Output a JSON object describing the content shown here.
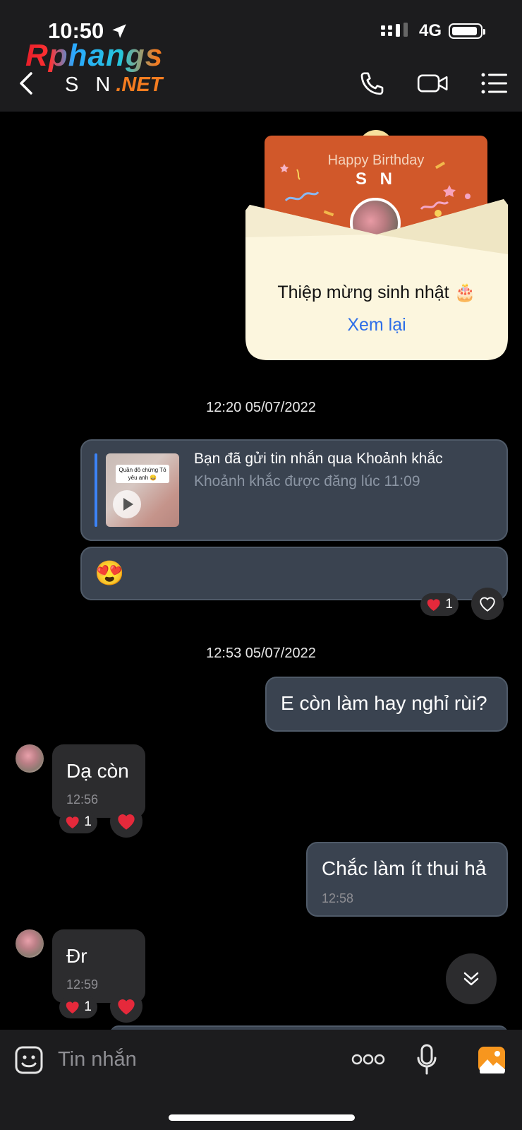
{
  "status_bar": {
    "time": "10:50",
    "network": "4G"
  },
  "header": {
    "logo_top": "Rphangs",
    "logo_letters": "S N",
    "logo_domain": ".NET"
  },
  "birthday_card": {
    "card_title": "Happy Birthday",
    "card_name": "S N",
    "label": "Thiệp mừng sinh nhật 🎂",
    "review_link": "Xem lại"
  },
  "timestamps": [
    "12:20 05/07/2022",
    "12:53 05/07/2022"
  ],
  "moment_message": {
    "thumb_caption": "Quần đô chứng Tô yêu anh 😄",
    "title": "Bạn đã gửi tin nhắn qua Khoảnh khắc",
    "subtitle": "Khoảnh khắc được đăng lúc 11:09"
  },
  "emoji_message": {
    "emoji": "😍",
    "reaction_count": "1"
  },
  "messages": [
    {
      "direction": "out",
      "text": "E còn làm hay nghỉ rùi?"
    },
    {
      "direction": "in",
      "text": "Dạ còn",
      "time": "12:56",
      "reaction_count": "1"
    },
    {
      "direction": "out",
      "text": "Chắc làm ít thui hả",
      "time": "12:58"
    },
    {
      "direction": "in",
      "text": "Đr",
      "time": "12:59",
      "reaction_count": "1"
    }
  ],
  "composer": {
    "placeholder": "Tin nhắn"
  },
  "colors": {
    "accent_blue": "#3c83f6",
    "card_orange": "#d1582a",
    "envelope": "#fcf6de",
    "gallery_orange": "#f7961e"
  }
}
